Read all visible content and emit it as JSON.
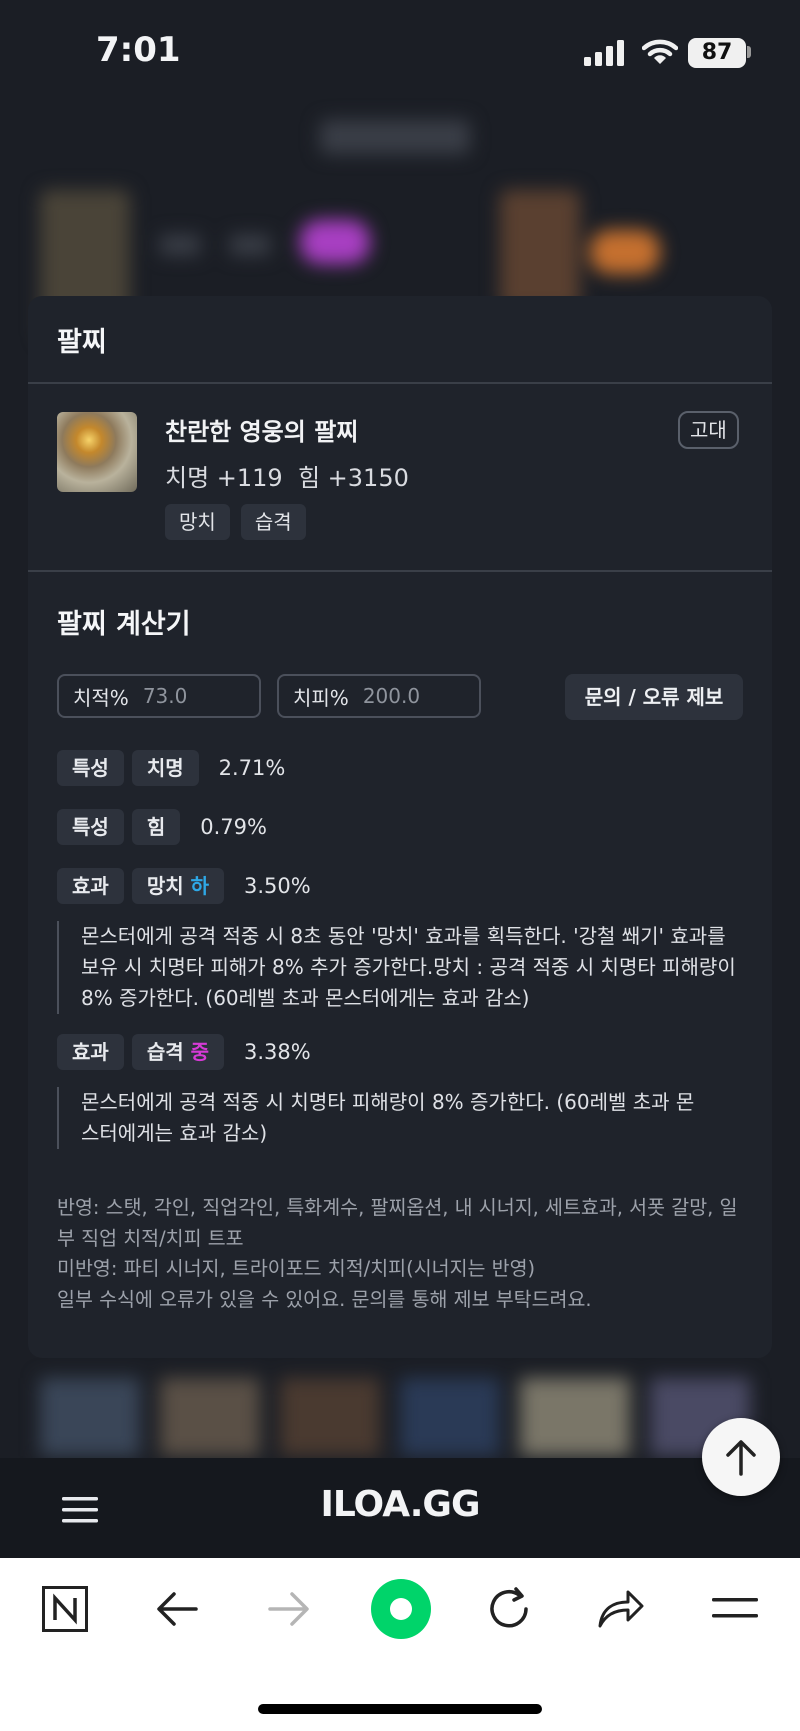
{
  "status_bar": {
    "time": "7:01",
    "battery": "87"
  },
  "card": {
    "section_title": "팔찌",
    "item": {
      "name": "찬란한 영웅의 팔찌",
      "stats": "치명 +119  힘 +3150",
      "tags": [
        "망치",
        "습격"
      ],
      "grade": "고대"
    },
    "calc_title": "팔찌 계산기",
    "inputs": [
      {
        "label": "치적%",
        "placeholder": "73.0"
      },
      {
        "label": "치피%",
        "placeholder": "200.0"
      }
    ],
    "report_button": "문의 / 오류 제보",
    "rows": [
      {
        "kind": "특성",
        "name": "치명",
        "level": "",
        "value": "2.71%"
      },
      {
        "kind": "특성",
        "name": "힘",
        "level": "",
        "value": "0.79%"
      },
      {
        "kind": "효과",
        "name": "망치",
        "level": "하",
        "level_color": "#2ea8e6",
        "value": "3.50%",
        "desc": "몬스터에게 공격 적중 시 8초 동안 '망치' 효과를 획득한다. '강철 쐐기' 효과를 보유 시 치명타 피해가 8% 추가 증가한다.망치 : 공격 적중 시 치명타 피해량이 8% 증가한다. (60레벨 초과 몬스터에게는 효과 감소)"
      },
      {
        "kind": "효과",
        "name": "습격",
        "level": "중",
        "level_color": "#d63ad6",
        "value": "3.38%",
        "desc": "몬스터에게 공격 적중 시 치명타 피해량이 8% 증가한다. (60레벨 초과 몬스터에게는 효과 감소)"
      }
    ],
    "notes": [
      "반영: 스탯, 각인, 직업각인, 특화계수, 팔찌옵션, 내 시너지, 세트효과, 서폿 갈망, 일부 직업 치적/치피 트포",
      "미반영: 파티 시너지, 트라이포드 치적/치피(시너지는 반영)",
      "일부 수식에 오류가 있을 수 있어요. 문의를 통해 제보 부탁드려요."
    ]
  },
  "site_bar": {
    "logo": "ILOA.GG"
  },
  "colors": {
    "background": "#1b1e25",
    "card": "#1f232b",
    "browser_accent": "#00d46a"
  }
}
